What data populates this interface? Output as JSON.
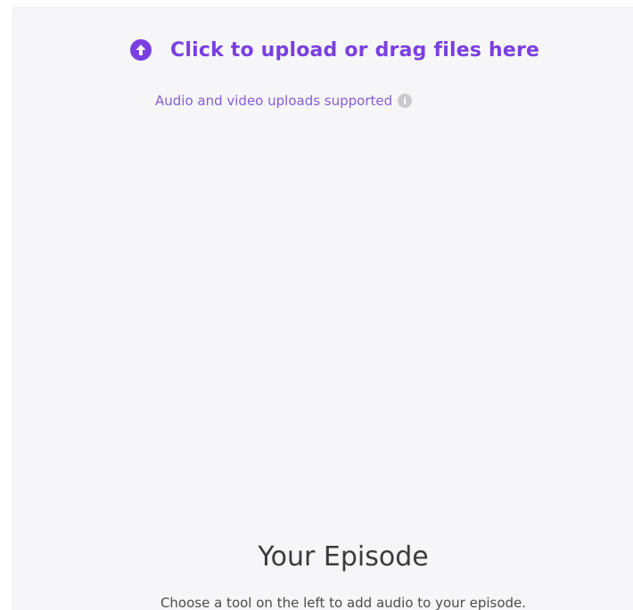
{
  "upload": {
    "label": "Click to upload or drag files here",
    "icon": "upload-arrow-circle-icon",
    "supported_text": "Audio and video uploads supported",
    "info_icon": "info-icon",
    "info_glyph": "i"
  },
  "episode": {
    "title": "Your Episode",
    "subtitle": "Choose a tool on the left to add audio to your episode."
  },
  "colors": {
    "accent": "#7a3fe0",
    "panel_background": "#f6f6f8",
    "title_text": "#3a3a3f"
  }
}
